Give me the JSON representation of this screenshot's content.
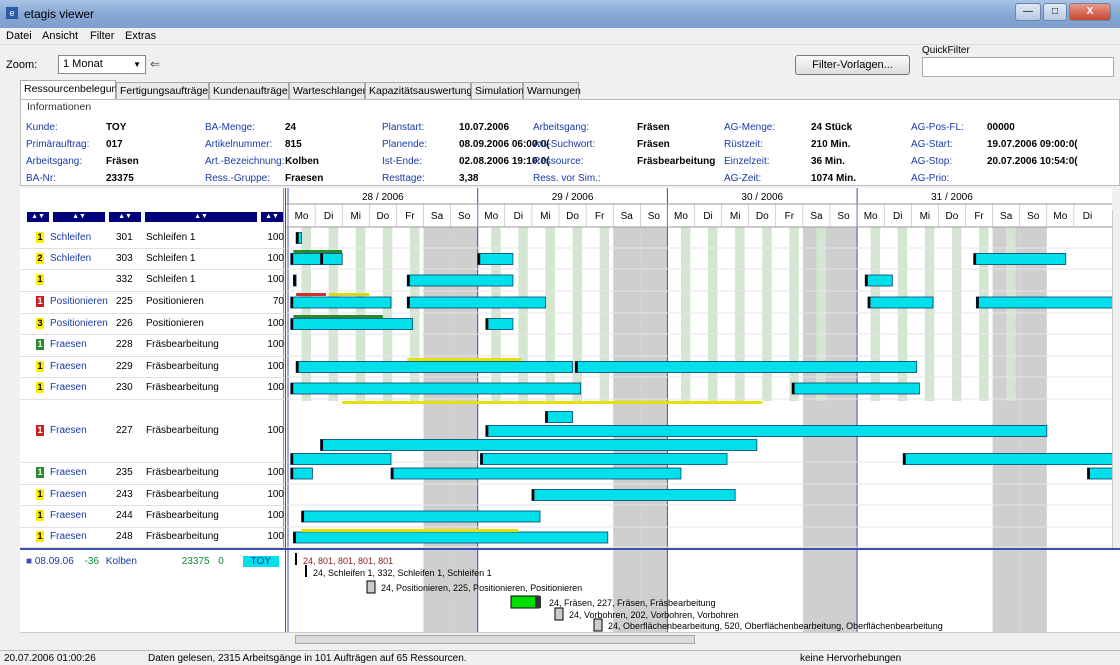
{
  "window": {
    "title": "etagis viewer",
    "app_icon": "etagis-app-icon"
  },
  "menu": [
    "Datei",
    "Ansicht",
    "Filter",
    "Extras"
  ],
  "toolbar": {
    "zoom_label": "Zoom:",
    "zoom_value": "1 Monat",
    "filter_button": "Filter-Vorlagen...",
    "quickfilter_label": "QuickFilter",
    "quickfilter_value": ""
  },
  "tabs": [
    "Ressourcenbelegung",
    "Fertigungsaufträge",
    "Kundenaufträge",
    "Warteschlangen",
    "Kapazitätsauswertung",
    "Simulation",
    "Warnungen"
  ],
  "active_tab": 0,
  "info": {
    "group_label": "Informationen",
    "fields": [
      {
        "label": "Kunde:",
        "value": "TOY"
      },
      {
        "label": "Primärauftrag:",
        "value": "017"
      },
      {
        "label": "Arbeitsgang:",
        "value": "Fräsen"
      },
      {
        "label": "BA-Nr:",
        "value": "23375"
      },
      {
        "label": "BA-Menge:",
        "value": "24"
      },
      {
        "label": "Artikelnummer:",
        "value": "815"
      },
      {
        "label": "Art.-Bezeichnung:",
        "value": "Kolben"
      },
      {
        "label": "Ress.-Gruppe:",
        "value": "Fraesen"
      },
      {
        "label": "Planstart:",
        "value": "10.07.2006"
      },
      {
        "label": "Planende:",
        "value": "08.09.2006 06:00:0("
      },
      {
        "label": "Ist-Ende:",
        "value": "02.08.2006 19:10:0("
      },
      {
        "label": "Resttage:",
        "value": "3,38"
      },
      {
        "label": "Arbeitsgang:",
        "value": "Fräsen"
      },
      {
        "label": "AG-Suchwort:",
        "value": "Fräsen"
      },
      {
        "label": "Ressource:",
        "value": "Fräsbearbeitung"
      },
      {
        "label": "Ress. vor Sim.:",
        "value": ""
      },
      {
        "label": "AG-Menge:",
        "value": "24 Stück"
      },
      {
        "label": "Rüstzeit:",
        "value": "210 Min."
      },
      {
        "label": "Einzelzeit:",
        "value": "36 Min."
      },
      {
        "label": "AG-Zeit:",
        "value": "1074 Min."
      },
      {
        "label": "AG-Pos-FL:",
        "value": "00000"
      },
      {
        "label": "AG-Start:",
        "value": "19.07.2006 09:00:0("
      },
      {
        "label": "AG-Stop:",
        "value": "20.07.2006 10:54:0("
      },
      {
        "label": "AG-Prio:",
        "value": ""
      }
    ]
  },
  "weeks": [
    "28 / 2006",
    "29 / 2006",
    "30 / 2006",
    "31 / 2006"
  ],
  "days": [
    "Mo",
    "Di",
    "Mi",
    "Do",
    "Fr",
    "Sa",
    "So",
    "Mo",
    "Di",
    "Mi",
    "Do",
    "Fr",
    "Sa",
    "So",
    "Mo",
    "Di",
    "Mi",
    "Do",
    "Fr",
    "Sa",
    "So",
    "Mo",
    "Di",
    "Mi",
    "Do",
    "Fr",
    "Sa",
    "So",
    "Mo",
    "Di"
  ],
  "resources": [
    {
      "prio": "1",
      "prio_color": "#ffee00",
      "group": "Schleifen",
      "nr": "301",
      "name": "Schleifen 1",
      "cap": "100"
    },
    {
      "prio": "2",
      "prio_color": "#ffee00",
      "group": "Schleifen",
      "nr": "303",
      "name": "Schleifen 1",
      "cap": "100"
    },
    {
      "prio": "1",
      "prio_color": "#ffee00",
      "group": "",
      "nr": "332",
      "name": "Schleifen 1",
      "cap": "100"
    },
    {
      "prio": "1",
      "prio_color": "#cc2020",
      "group": "Positionieren",
      "nr": "225",
      "name": "Positionieren",
      "cap": "70"
    },
    {
      "prio": "3",
      "prio_color": "#ffee00",
      "group": "Positionieren",
      "nr": "226",
      "name": "Positionieren",
      "cap": "100"
    },
    {
      "prio": "1",
      "prio_color": "#2a8a2a",
      "group": "Fraesen",
      "nr": "228",
      "name": "Fräsbearbeitung",
      "cap": "100"
    },
    {
      "prio": "1",
      "prio_color": "#ffee00",
      "group": "Fraesen",
      "nr": "229",
      "name": "Fräsbearbeitung",
      "cap": "100"
    },
    {
      "prio": "1",
      "prio_color": "#ffee00",
      "group": "Fraesen",
      "nr": "230",
      "name": "Fräsbearbeitung",
      "cap": "100"
    },
    {
      "prio": "1",
      "prio_color": "#cc2020",
      "group": "Fraesen",
      "nr": "227",
      "name": "Fräsbearbeitung",
      "cap": "100"
    },
    {
      "prio": "1",
      "prio_color": "#2a8a2a",
      "group": "Fraesen",
      "nr": "235",
      "name": "Fräsbearbeitung",
      "cap": "100"
    },
    {
      "prio": "1",
      "prio_color": "#ffee00",
      "group": "Fraesen",
      "nr": "243",
      "name": "Fräsbearbeitung",
      "cap": "100"
    },
    {
      "prio": "1",
      "prio_color": "#ffee00",
      "group": "Fraesen",
      "nr": "244",
      "name": "Fräsbearbeitung",
      "cap": "100"
    },
    {
      "prio": "1",
      "prio_color": "#ffee00",
      "group": "Fraesen",
      "nr": "248",
      "name": "Fräsbearbeitung",
      "cap": "100"
    }
  ],
  "order_summary": {
    "date": "08.09.06",
    "delta": "-36",
    "article": "Kolben",
    "ba": "23375",
    "zero": "0",
    "customer": "TOY"
  },
  "timeline_labels": [
    "24, 801, 801, 801, 801",
    "24, Schleifen 1, 332, Schleifen 1, Schleifen 1",
    "24, Positionieren, 225, Positionieren, Positionieren",
    "24, Fräsen, 227, Fräsen, Fräsbearbeitung",
    "24, Vorbohren, 202, Vorbohren, Vorbohren",
    "24, Oberflächenbearbeitung, 520, Oberflächenbearbeitung, Oberflächenbearbeitung"
  ],
  "status": {
    "time": "20.07.2006 01:00:26",
    "message": "Daten gelesen, 2315 Arbeitsgänge in 101 Aufträgen auf 65 Ressourcen.",
    "highlight": "keine Hervorhebungen"
  },
  "colors": {
    "bar": "#00e0ea",
    "weekend": "#c8c8c8",
    "free": "#cde0cd",
    "accent": "#3c4fb0"
  }
}
